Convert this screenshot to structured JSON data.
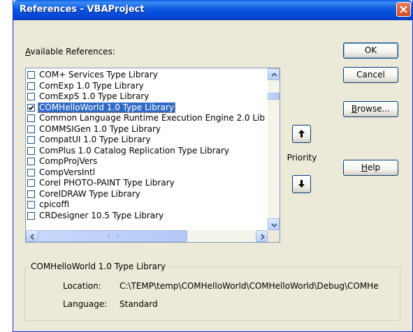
{
  "window": {
    "title": "References - VBAProject",
    "close_icon": "close-icon"
  },
  "available_label": {
    "mnemonic": "A",
    "rest": "vailable References:"
  },
  "references": [
    {
      "name": "COM+ Services Type Library",
      "checked": false
    },
    {
      "name": "ComExp 1.0 Type Library",
      "checked": false
    },
    {
      "name": "ComExpS 1.0 Type Library",
      "checked": false
    },
    {
      "name": "COMHelloWorld 1.0 Type Library",
      "checked": true,
      "selected": true
    },
    {
      "name": "Common Language Runtime Execution Engine 2.0 Lib",
      "checked": false
    },
    {
      "name": "COMMSIGen 1.0 Type Library",
      "checked": false
    },
    {
      "name": "CompatUI 1.0 Type Library",
      "checked": false
    },
    {
      "name": "ComPlus 1.0 Catalog Replication Type Library",
      "checked": false
    },
    {
      "name": "CompProjVers",
      "checked": false
    },
    {
      "name": "CompVersIntl",
      "checked": false
    },
    {
      "name": "Corel PHOTO-PAINT Type Library",
      "checked": false
    },
    {
      "name": "CorelDRAW Type Library",
      "checked": false
    },
    {
      "name": "cpicoffi",
      "checked": false
    },
    {
      "name": "CRDesigner 10.5 Type Library",
      "checked": false
    }
  ],
  "buttons": {
    "ok": "OK",
    "cancel": "Cancel",
    "browse_mnemonic": "B",
    "browse_rest": "rowse...",
    "help_mnemonic": "H",
    "help_rest": "elp"
  },
  "priority": {
    "label": "Priority",
    "up_icon": "arrow-up-icon",
    "down_icon": "arrow-down-icon"
  },
  "details": {
    "group_title": "COMHelloWorld 1.0 Type Library",
    "location_label": "Location:",
    "location_value": "C:\\TEMP\\temp\\COMHelloWorld\\COMHelloWorld\\Debug\\COMHe",
    "language_label": "Language:",
    "language_value": "Standard"
  },
  "colors": {
    "titlebar": "#0548d8",
    "selection": "#316ac5",
    "dialog_bg": "#ece9d8"
  }
}
